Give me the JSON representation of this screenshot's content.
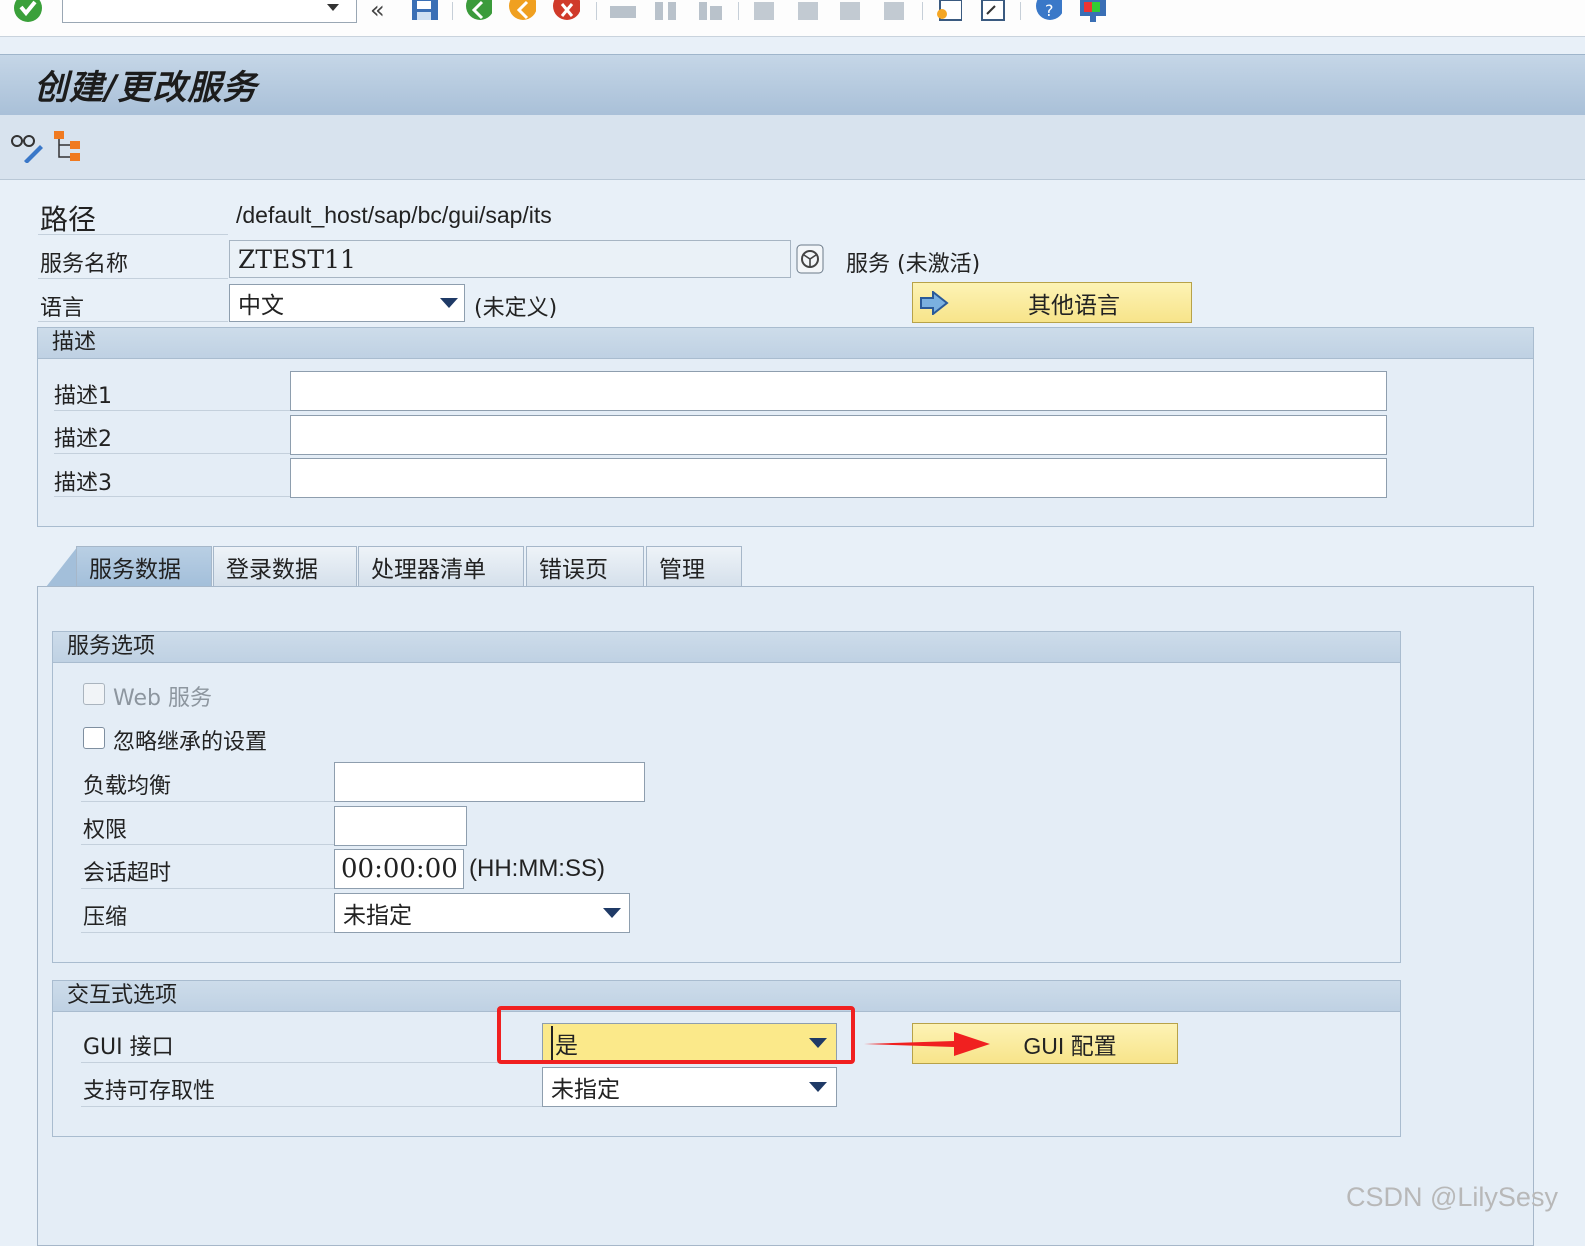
{
  "toolbar": {
    "enter_icon": "check-icon",
    "command_value": "",
    "icons": [
      "back-icon",
      "save-icon",
      "back-green-icon",
      "exit-icon",
      "cancel-icon",
      "print-icon",
      "find-icon",
      "find-next-icon",
      "first-page-icon",
      "prev-page-icon",
      "next-page-icon",
      "last-page-icon",
      "new-session-icon",
      "shortcut-icon",
      "help-icon",
      "layout-icon"
    ]
  },
  "title": "创建/更改服务",
  "form": {
    "path_label": "路径",
    "path_value": "/default_host/sap/bc/gui/sap/its",
    "service_name_label": "服务名称",
    "service_name_value": "ZTEST11",
    "service_status": "服务 (未激活)",
    "language_label": "语言",
    "language_value": "中文",
    "language_status": "(未定义)",
    "other_language_button": "其他语言"
  },
  "description": {
    "header": "描述",
    "rows": [
      {
        "label": "描述1",
        "value": ""
      },
      {
        "label": "描述2",
        "value": ""
      },
      {
        "label": "描述3",
        "value": ""
      }
    ]
  },
  "tabs": [
    "服务数据",
    "登录数据",
    "处理器清单",
    "错误页",
    "管理"
  ],
  "service_options": {
    "header": "服务选项",
    "web_service_label": "Web 服务",
    "ignore_inherited_label": "忽略继承的设置",
    "load_balance_label": "负载均衡",
    "load_balance_value": "",
    "authority_label": "权限",
    "authority_value": "",
    "session_timeout_label": "会话超时",
    "session_timeout_value": "00:00:00",
    "session_timeout_unit": "(HH:MM:SS)",
    "compression_label": "压缩",
    "compression_value": "未指定"
  },
  "interactive_options": {
    "header": "交互式选项",
    "gui_interface_label": "GUI 接口",
    "gui_interface_value": "是",
    "gui_config_button": "GUI 配置",
    "accessibility_label": "支持可存取性",
    "accessibility_value": "未指定"
  },
  "watermark": "CSDN @LilySesy",
  "colors": {
    "highlight": "#f02020",
    "button": "#f7e48a",
    "title_bar": "#a9c0d8"
  }
}
